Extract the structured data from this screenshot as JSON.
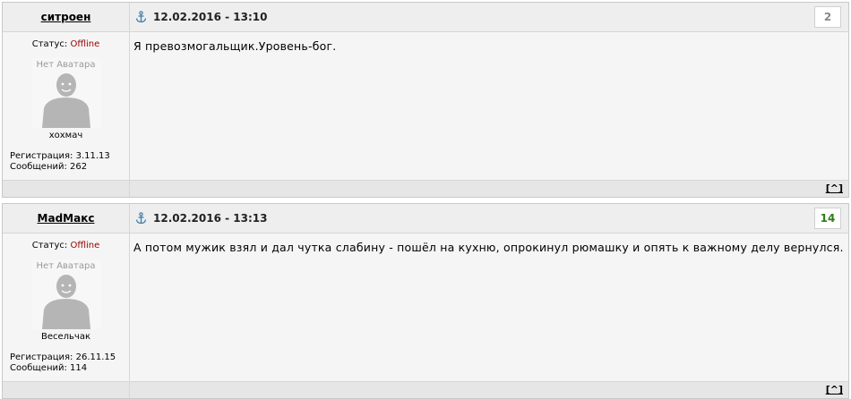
{
  "posts": [
    {
      "author": "ситроен",
      "date": "12.02.2016 - 13:10",
      "number": "2",
      "number_color": "#888888",
      "status_label": "Статус:",
      "status_value": "Offline",
      "avatar_text": "Нет Аватара",
      "rank": "хохмач",
      "registration": "Регистрация: 3.11.13",
      "messages_count": "Сообщений: 262",
      "message": "Я превозмогальщик.Уровень-бог.",
      "to_top": "[^]"
    },
    {
      "author": "MadМакс",
      "date": "12.02.2016 - 13:13",
      "number": "14",
      "number_color": "#2e7d1a",
      "status_label": "Статус:",
      "status_value": "Offline",
      "avatar_text": "Нет Аватара",
      "rank": "Весельчак",
      "registration": "Регистрация: 26.11.15",
      "messages_count": "Сообщений: 114",
      "message": "А потом мужик взял и дал чутка слабину - пошёл на кухню, опрокинул рюмашку и опять к важному делу вернулся.",
      "to_top": "[^]"
    }
  ],
  "colors": {
    "offline": "#990000",
    "anchor_icon": "#4a7fa8",
    "avatar_silhouette": "#b5b5b5"
  }
}
